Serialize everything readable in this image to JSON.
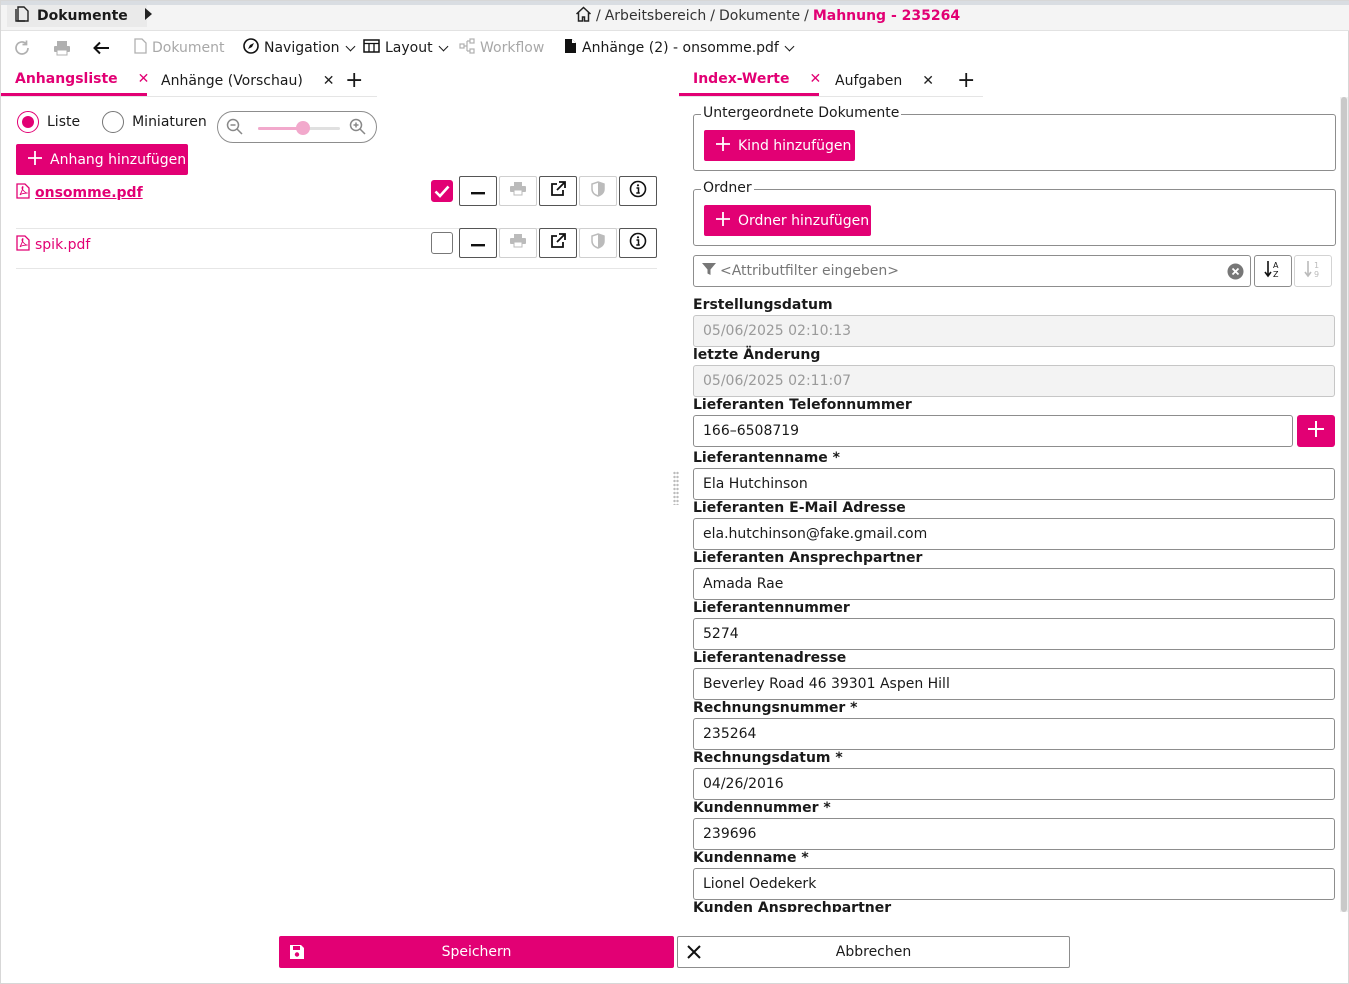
{
  "header": {
    "doc_tab_label": "Dokumente",
    "breadcrumb": [
      "Arbeitsbereich",
      "Dokumente"
    ],
    "breadcrumb_active": "Mahnung - 235264"
  },
  "toolbar": {
    "document": "Dokument",
    "navigation": "Navigation",
    "layout": "Layout",
    "workflow": "Workflow",
    "attachments": "Anhänge (2) - onsomme.pdf"
  },
  "left_tabs": [
    {
      "label": "Anhangsliste",
      "active": true
    },
    {
      "label": "Anhänge (Vorschau)",
      "active": false
    }
  ],
  "view_mode": {
    "list_label": "Liste",
    "thumbnails_label": "Miniaturen",
    "selected": "Liste",
    "zoom_level": 0.55
  },
  "add_attachment_label": "Anhang hinzufügen",
  "attachments": [
    {
      "name": "onsomme.pdf",
      "checked": true
    },
    {
      "name": "spik.pdf",
      "checked": false
    }
  ],
  "right_tabs": [
    {
      "label": "Index-Werte",
      "active": true
    },
    {
      "label": "Aufgaben",
      "active": false
    }
  ],
  "child_docs": {
    "legend": "Untergeordnete Dokumente",
    "button": "Kind hinzufügen"
  },
  "folders": {
    "legend": "Ordner",
    "button": "Ordner hinzufügen"
  },
  "filter": {
    "placeholder": "<Attributfilter eingeben>"
  },
  "fields": [
    {
      "label": "Erstellungsdatum",
      "value": "05/06/2025 02:10:13",
      "readonly": true
    },
    {
      "label": "letzte Änderung",
      "value": "05/06/2025 02:11:07",
      "readonly": true
    },
    {
      "label": "Lieferanten Telefonnummer",
      "value": "166–6508719",
      "readonly": false
    },
    {
      "label": "Lieferantenname *",
      "value": "Ela Hutchinson",
      "readonly": false
    },
    {
      "label": "Lieferanten E-Mail Adresse",
      "value": "ela.hutchinson@fake.gmail.com",
      "readonly": false
    },
    {
      "label": "Lieferanten Ansprechpartner",
      "value": "Amada Rae",
      "readonly": false
    },
    {
      "label": "Lieferantennummer",
      "value": "5274",
      "readonly": false
    },
    {
      "label": "Lieferantenadresse",
      "value": "Beverley Road 46 39301 Aspen Hill",
      "readonly": false
    },
    {
      "label": "Rechnungsnummer *",
      "value": "235264",
      "readonly": false
    },
    {
      "label": "Rechnungsdatum *",
      "value": "04/26/2016",
      "readonly": false
    },
    {
      "label": "Kundennummer *",
      "value": "239696",
      "readonly": false
    },
    {
      "label": "Kundenname *",
      "value": "Lionel Oedekerk",
      "readonly": false
    },
    {
      "label": "Kunden Ansprechpartner",
      "value": "",
      "readonly": false
    }
  ],
  "footer": {
    "save_label": "Speichern",
    "cancel_label": "Abbrechen"
  },
  "colors": {
    "accent": "#e20074"
  }
}
